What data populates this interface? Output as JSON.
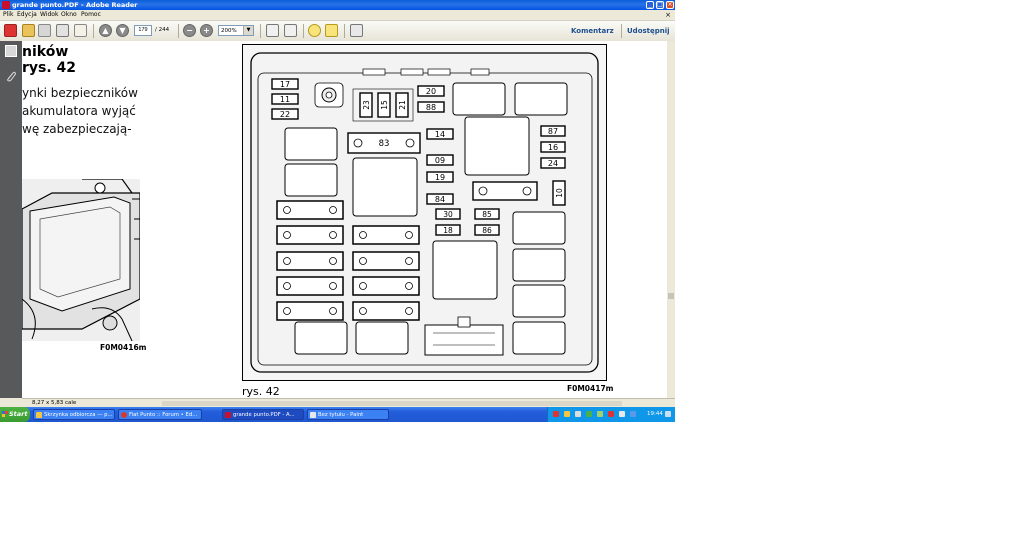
{
  "window": {
    "title": "grande punto.PDF - Adobe Reader"
  },
  "menu": {
    "items": [
      "Plik",
      "Edycja",
      "Widok",
      "Okno",
      "Pomoc"
    ],
    "close_glyph": "×"
  },
  "toolbar": {
    "page_current": "179",
    "page_total": "/ 244",
    "zoom": "200%",
    "comment_label": "Komentarz",
    "share_label": "Udostępnij"
  },
  "document": {
    "heading_line1": "ników",
    "heading_line2": "rys. 42",
    "body_lines": [
      "ynki bezpieczników",
      "akumulatora wyjąć",
      "wę zabezpieczają-"
    ],
    "fig_left_caption": "F0M0416m",
    "fig_main_caption": "F0M0417m",
    "fig_main_label": "rys. 42",
    "fuse_labels": {
      "left_stack": [
        "17",
        "11",
        "22"
      ],
      "vertical": [
        "23",
        "15",
        "21"
      ],
      "top_right": [
        "20",
        "88"
      ],
      "center": [
        "83"
      ],
      "mid_column": [
        "14",
        "09",
        "19",
        "84"
      ],
      "small_pairs": [
        "30",
        "85",
        "18",
        "86"
      ],
      "right_column": [
        "87",
        "16",
        "24"
      ],
      "right_vertical": [
        "10"
      ]
    }
  },
  "status": {
    "page_size": "8,27 x 5,83 cale"
  },
  "taskbar": {
    "start_label": "Start",
    "items": [
      "Skrzynka odbiorcza — p...",
      "Fiat Punto :: Forum • Ed...",
      "grande punto.PDF - A...",
      "Bez tytułu - Paint"
    ],
    "clock": "19:44"
  }
}
